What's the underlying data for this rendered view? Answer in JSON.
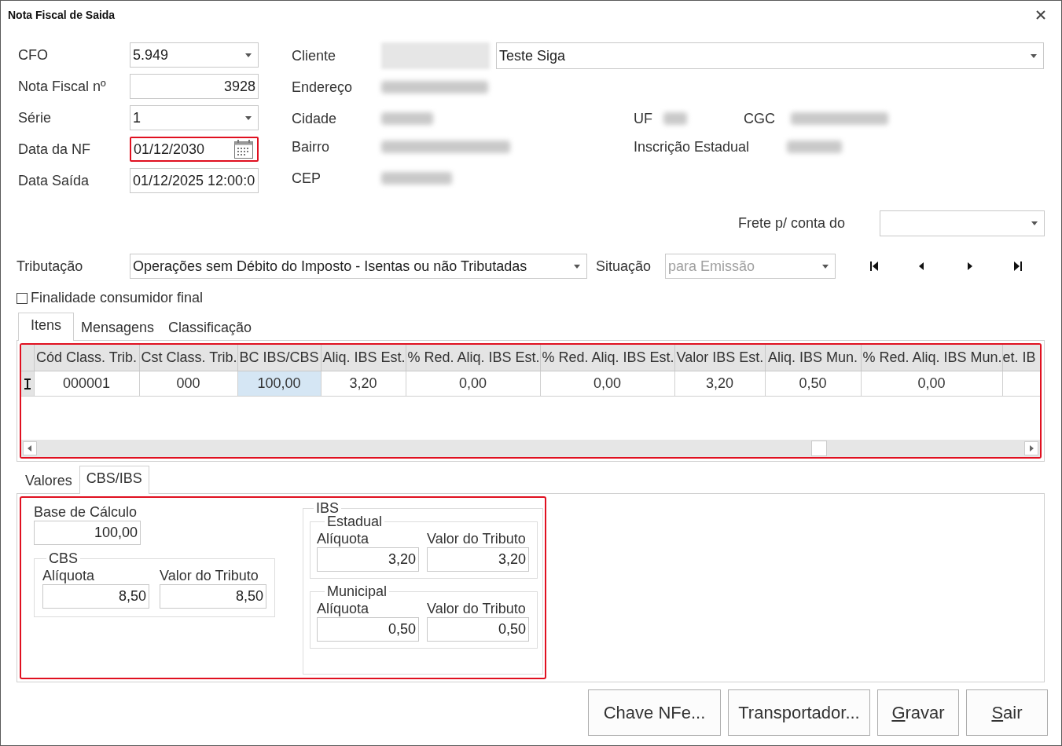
{
  "window": {
    "title": "Nota Fiscal de Saida"
  },
  "header_fields": [
    {
      "label": "CFO",
      "kind": "combo",
      "value": "5.949",
      "highlighted": false
    },
    {
      "label": "Nota Fiscal nº",
      "kind": "number",
      "value": "3928",
      "highlighted": false
    },
    {
      "label": "Série",
      "kind": "combo",
      "value": "1",
      "highlighted": false
    },
    {
      "label": "Data da NF",
      "kind": "date",
      "value": "01/12/2030",
      "highlighted": true
    },
    {
      "label": "Data Saída",
      "kind": "text",
      "value": "01/12/2025 12:00:0",
      "highlighted": false
    }
  ],
  "customer": {
    "label": "Cliente",
    "code_redacted": true,
    "name": "Teste Siga",
    "address": {
      "label": "Endereço",
      "value_redacted": true
    },
    "city": {
      "label": "Cidade",
      "value_redacted": true
    },
    "state": {
      "label": "UF",
      "value_redacted": true
    },
    "tax_id": {
      "label": "CGC",
      "value_redacted": true
    },
    "district": {
      "label": "Bairro",
      "value_redacted": true
    },
    "state_registration": {
      "label": "Inscrição Estadual",
      "value_redacted": true
    },
    "zip": {
      "label": "CEP",
      "value_redacted": true
    }
  },
  "freight": {
    "label": "Frete p/ conta do"
  },
  "taxation": {
    "label": "Tributação",
    "value": "Operações sem Débito do Imposto - Isentas ou não Tributadas"
  },
  "situation": {
    "label": "Situação",
    "value": "para Emissão",
    "disabled": true
  },
  "navigation": [
    {
      "kind": "first"
    },
    {
      "kind": "prev"
    },
    {
      "kind": "next"
    },
    {
      "kind": "last"
    }
  ],
  "final_consumer": {
    "label": "Finalidade consumidor final",
    "checked": false
  },
  "tabs": [
    {
      "label": "Itens",
      "selected": true
    },
    {
      "label": "Mensagens",
      "selected": false
    },
    {
      "label": "Classificação",
      "selected": false
    }
  ],
  "items_grid": {
    "highlighted": true,
    "columns": [
      "Cód Class. Trib.",
      "Cst Class. Trib.",
      "BC IBS/CBS",
      "Aliq. IBS Est.",
      "% Red. Aliq. IBS Est.",
      "% Red. Aliq. IBS Est.",
      "Valor IBS Est.",
      "Aliq. IBS Mun.",
      "% Red. Aliq. IBS Mun.",
      "et. IB"
    ],
    "rows": [
      {
        "editing": true,
        "cells": [
          {
            "text": "000001",
            "selected": false
          },
          {
            "text": "000",
            "selected": false
          },
          {
            "text": "100,00",
            "selected": true
          },
          {
            "text": "3,20",
            "selected": false
          },
          {
            "text": "0,00",
            "selected": false
          },
          {
            "text": "0,00",
            "selected": false
          },
          {
            "text": "3,20",
            "selected": false
          },
          {
            "text": "0,50",
            "selected": false
          },
          {
            "text": "0,00",
            "selected": false
          },
          {
            "text": "",
            "selected": false
          }
        ]
      }
    ]
  },
  "lower_tabs": [
    {
      "label": "Valores",
      "selected": false
    },
    {
      "label": "CBS/IBS",
      "selected": true
    }
  ],
  "cbs_ibs": {
    "highlighted": true,
    "base": {
      "label": "Base de Cálculo",
      "value": "100,00"
    },
    "cbs": {
      "title": "CBS",
      "rate": {
        "label": "Alíquota",
        "value": "8,50"
      },
      "amount": {
        "label": "Valor do Tributo",
        "value": "8,50"
      }
    },
    "ibs": {
      "title": "IBS",
      "groups": [
        {
          "title": "Estadual",
          "rate": {
            "label": "Alíquota",
            "value": "3,20"
          },
          "amount": {
            "label": "Valor do Tributo",
            "value": "3,20"
          }
        },
        {
          "title": "Municipal",
          "rate": {
            "label": "Alíquota",
            "value": "0,50"
          },
          "amount": {
            "label": "Valor do Tributo",
            "value": "0,50"
          }
        }
      ]
    }
  },
  "buttons": [
    {
      "label": "Chave NFe...",
      "underline_first": false
    },
    {
      "label": "Transportador...",
      "underline_first": false
    },
    {
      "label": "Gravar",
      "underline_first": true
    },
    {
      "label": "Sair",
      "underline_first": true
    }
  ]
}
